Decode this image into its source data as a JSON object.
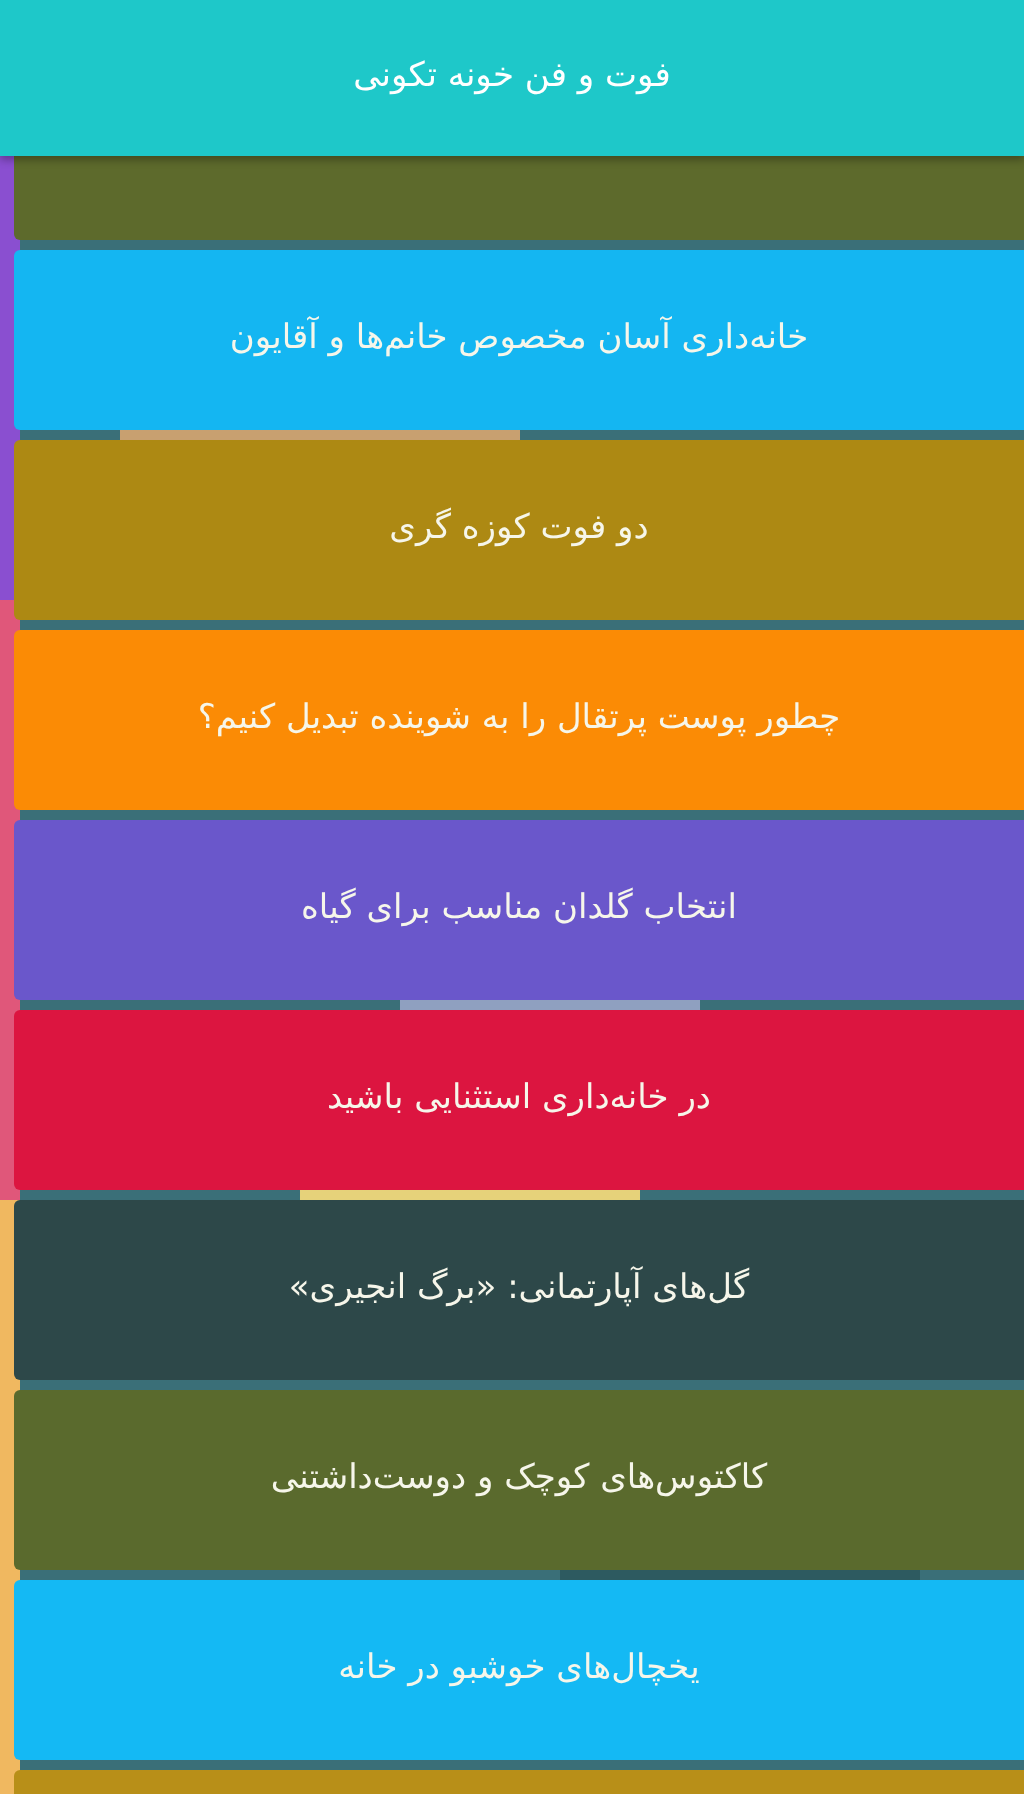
{
  "app_bar": {
    "title": "فوت و فن خونه تکونی"
  },
  "items": [
    {
      "color": "#5d6a2c"
    },
    {
      "title": "خانه‌داری آسان مخصوص خانم‌ها و آقایون",
      "color": "#14b6f2"
    },
    {
      "title": "دو فوت کوزه گری",
      "color": "#ad8913"
    },
    {
      "title": "چطور پوست پرتقال را به شوینده تبدیل کنیم؟",
      "color": "#fb8b05"
    },
    {
      "title": "انتخاب گلدان مناسب برای گیاه",
      "color": "#6a57cb"
    },
    {
      "title": "در خانه‌داری استثنایی باشید",
      "color": "#dc1540"
    },
    {
      "title": "گل‌های آپارتمانی: «برگ انجیری»",
      "color": "#2d4849"
    },
    {
      "title": "کاکتوس‌های کوچک و دوست‌داشتنی",
      "color": "#5a6a2d"
    },
    {
      "title": "یخچال‌های خوشبو در خانه",
      "color": "#14b9f4"
    },
    {
      "color": "#b88f18"
    }
  ]
}
